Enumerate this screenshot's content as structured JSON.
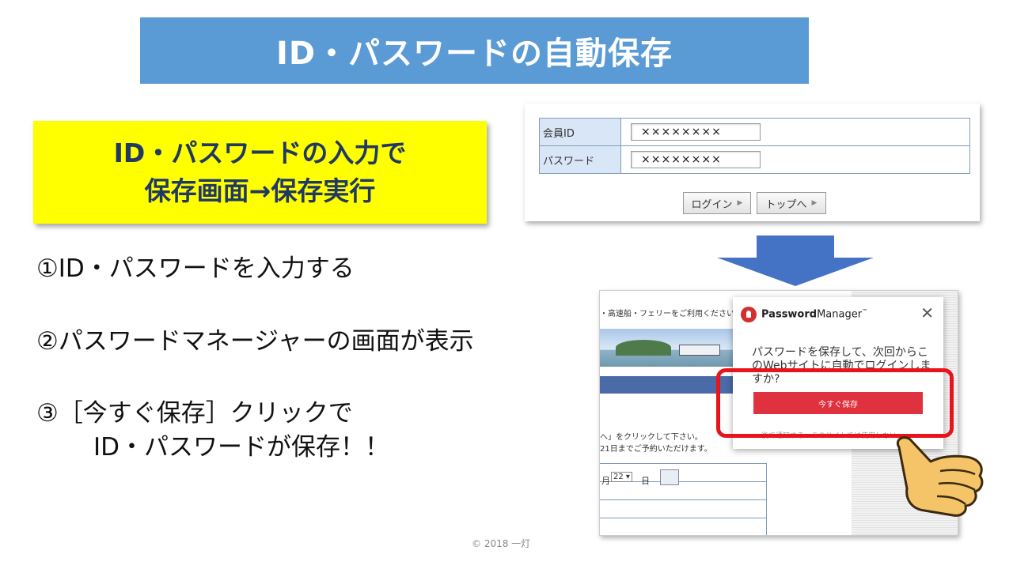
{
  "slide": {
    "title": "ID・パスワードの自動保存",
    "callout": {
      "line1": "ID・パスワードの入力で",
      "line2": "保存画面→保存実行"
    },
    "steps": {
      "s1": "①ID・パスワードを入力する",
      "s2": "②パスワードマネージャーの画面が表示",
      "s3a": "③［今すぐ保存］クリックで",
      "s3b": "ID・パスワードが保存！！"
    },
    "copyright": "© 2018 一灯"
  },
  "login_form": {
    "rows": [
      {
        "label": "会員ID",
        "value": "××××××××"
      },
      {
        "label": "パスワード",
        "value": "××××××××"
      }
    ],
    "login_button": "ログイン",
    "top_button": "トップへ",
    "button_icon": "play-arrow-icon"
  },
  "password_manager": {
    "page_strip": "・高速船・フェリーをご利用ください",
    "page_text1": "へ」をクリックして下さい。",
    "page_text2": "21日までご予約いただけます。",
    "date_month": "月",
    "date_day_value": "22 ▾",
    "date_day": "日",
    "brand_bold": "Password",
    "brand_rest": "Manager",
    "brand_tm": "™",
    "close": "✕",
    "message": "パスワードを保存して、次回からこのWebサイトに自動でログインしますか?",
    "save_button": "今すぐ保存",
    "footer": "後で通知する　このサイトでは使用しない"
  },
  "colors": {
    "banner": "#5b9bd5",
    "callout": "#ffff00",
    "arrow": "#4472c4",
    "save": "#e0313e",
    "highlight": "#e8141c"
  }
}
